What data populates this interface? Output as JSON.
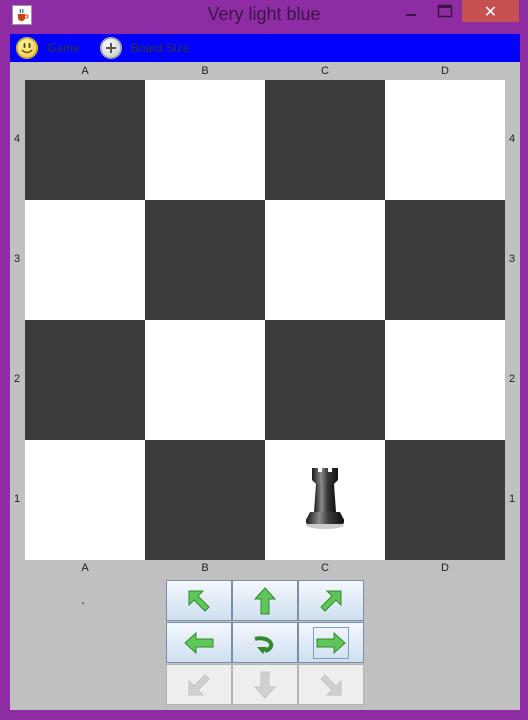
{
  "window": {
    "title": "Very light blue",
    "icon": "java-cup-icon",
    "close_glyph": "✕",
    "frame_color": "#8e2ca3"
  },
  "menubar": {
    "background": "#0000ff",
    "items": [
      {
        "label": "Game",
        "icon": "smiley-icon"
      },
      {
        "label": "Board Size",
        "icon": "plus-icon"
      }
    ]
  },
  "board": {
    "files_top": [
      "A",
      "B",
      "C",
      "D"
    ],
    "files_bottom": [
      "A",
      "B",
      "C",
      "D"
    ],
    "ranks_left": [
      "4",
      "3",
      "2",
      "1"
    ],
    "ranks_right": [
      "4",
      "3",
      "2",
      "1"
    ],
    "dark_color": "#3c3c3c",
    "light_color": "#ffffff",
    "pieces": [
      {
        "square": "C1",
        "type": "rook",
        "color": "black"
      }
    ]
  },
  "status": {
    "text": "."
  },
  "navigation": {
    "buttons": [
      {
        "name": "move-up-left-button",
        "icon": "arrow-up-left-icon",
        "enabled": true
      },
      {
        "name": "move-up-button",
        "icon": "arrow-up-icon",
        "enabled": true
      },
      {
        "name": "move-up-right-button",
        "icon": "arrow-up-right-icon",
        "enabled": true
      },
      {
        "name": "move-left-button",
        "icon": "arrow-left-icon",
        "enabled": true
      },
      {
        "name": "rotate-button",
        "icon": "rotate-icon",
        "enabled": true
      },
      {
        "name": "move-right-button",
        "icon": "arrow-right-icon",
        "enabled": true
      },
      {
        "name": "move-down-left-button",
        "icon": "arrow-down-left-icon",
        "enabled": false
      },
      {
        "name": "move-down-button",
        "icon": "arrow-down-icon",
        "enabled": false
      },
      {
        "name": "move-down-right-button",
        "icon": "arrow-down-right-icon",
        "enabled": false
      }
    ]
  }
}
